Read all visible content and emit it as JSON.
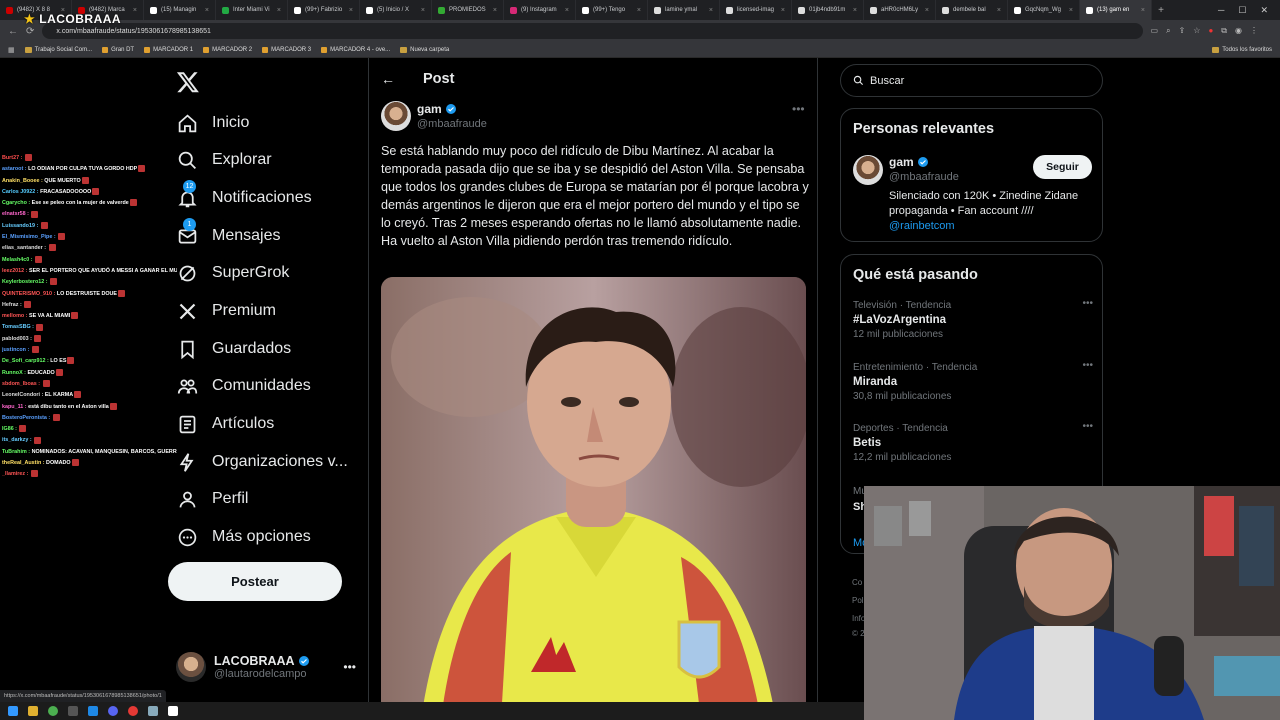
{
  "browser": {
    "tabs": [
      {
        "label": "(9482) X  8 8",
        "color": "#cc0000"
      },
      {
        "label": "(9482) Marca",
        "color": "#cc0000"
      },
      {
        "label": "(15) Managin",
        "color": "#ffffff"
      },
      {
        "label": "Inter Miami Vi",
        "color": "#22aa44"
      },
      {
        "label": "(99+) Fabrizio",
        "color": "#ffffff"
      },
      {
        "label": "(5) Inicio / X",
        "color": "#ffffff"
      },
      {
        "label": "PROMIEDOS",
        "color": "#33aa33"
      },
      {
        "label": "(9) Instagram",
        "color": "#d62976"
      },
      {
        "label": "(99+) Tengo",
        "color": "#ffffff"
      },
      {
        "label": "lamine ymal",
        "color": "#dddddd"
      },
      {
        "label": "licensed-imag",
        "color": "#dddddd"
      },
      {
        "label": "01jb4ndb91m",
        "color": "#dddddd"
      },
      {
        "label": "aHR0cHM6Ly",
        "color": "#dddddd"
      },
      {
        "label": "dembele bal",
        "color": "#dddddd"
      },
      {
        "label": "GqcNqm_Wg",
        "color": "#ffffff"
      },
      {
        "label": "(13) gam en",
        "color": "#ffffff"
      }
    ],
    "url": "x.com/mbaafraude/status/1953061678985138651",
    "bookmarks": [
      "Trabajo Social Com...",
      "Gran DT",
      "MARCADOR 1",
      "MARCADOR 2",
      "MARCADOR 3",
      "MARCADOR 4 - ove...",
      "Nueva carpeta"
    ],
    "all_bookmarks": "Todos los favoritos",
    "status_url": "https://x.com/mbaafraude/status/1953061678985138651/photo/1"
  },
  "overlay_logo": "LACOBRAAA",
  "chat": [
    {
      "user": "Burt27 :",
      "msg": "",
      "color": "#ff4d4d"
    },
    {
      "user": "astaroot :",
      "msg": "LO ODIAN POR CULPA TUYA GORDO HDP",
      "color": "#5aa0ff"
    },
    {
      "user": "Anakin_Booee :",
      "msg": "QUE MUERTO",
      "color": "#ffe066"
    },
    {
      "user": "Carlos J0922 :",
      "msg": "FRACASADOOOOO",
      "color": "#55ccff"
    },
    {
      "user": "Cgarycho :",
      "msg": "Ese se peleo con la mujer de valverde",
      "color": "#66ff66"
    },
    {
      "user": "elnatsr58 :",
      "msg": "",
      "color": "#ff66cc"
    },
    {
      "user": "Luissando19 :",
      "msg": "",
      "color": "#66ccff"
    },
    {
      "user": "El_Mismisimo_Pipe :",
      "msg": "",
      "color": "#5aa0ff"
    },
    {
      "user": "elias_santander :",
      "msg": "",
      "color": "#dddddd"
    },
    {
      "user": "Melash4c0 :",
      "msg": "",
      "color": "#66ff66"
    },
    {
      "user": "leez2012 :",
      "msg": "SER EL PORTERO QUE AYUDÓ A MESSI A GANAR EL MUNDIAL COGIDOS",
      "color": "#ff5555"
    },
    {
      "user": "Keylerbostero12 :",
      "msg": "",
      "color": "#66ff66"
    },
    {
      "user": "QUINTERISMO_910 :",
      "msg": "LO DESTRUISTE DOUE",
      "color": "#ff5555"
    },
    {
      "user": "Hefraz :",
      "msg": "",
      "color": "#dddddd"
    },
    {
      "user": "mellomo :",
      "msg": "SE VA AL MIAMI",
      "color": "#ff5555"
    },
    {
      "user": "TomasSBG :",
      "msg": "",
      "color": "#66ccff"
    },
    {
      "user": "pablod003 :",
      "msg": "",
      "color": "#dddddd"
    },
    {
      "user": "justincon :",
      "msg": "",
      "color": "#5aa0ff"
    },
    {
      "user": "De_Sofi_carp912 :",
      "msg": "LO ES",
      "color": "#66ff66"
    },
    {
      "user": "RunnoX :",
      "msg": "EDUCADO",
      "color": "#66ff66"
    },
    {
      "user": "sbdom_lboas :",
      "msg": "",
      "color": "#ff5555"
    },
    {
      "user": "LeonelCondori :",
      "msg": "EL KARMA",
      "color": "#dddddd"
    },
    {
      "user": "kapu_11 :",
      "msg": "está dibu tanto en el Aston villa",
      "color": "#ff66cc"
    },
    {
      "user": "BosteroPeronista :",
      "msg": "",
      "color": "#5aa0ff"
    },
    {
      "user": "IG86 :",
      "msg": "",
      "color": "#66ff66"
    },
    {
      "user": "its_darkzy :",
      "msg": "",
      "color": "#66ccff"
    },
    {
      "user": "TuBrahim :",
      "msg": "NOMINADOS: ACAVANI, MANQUESIN, BARCOS, GUERRERO",
      "color": "#66ff66"
    },
    {
      "user": "theReal_Austin :",
      "msg": "DOMADO",
      "color": "#ffe066"
    },
    {
      "user": "_llamirez :",
      "msg": "",
      "color": "#ff5555"
    }
  ],
  "nav": [
    {
      "label": "Inicio",
      "icon": "home-icon"
    },
    {
      "label": "Explorar",
      "icon": "search-icon"
    },
    {
      "label": "Notificaciones",
      "icon": "bell-icon",
      "badge": "12"
    },
    {
      "label": "Mensajes",
      "icon": "mail-icon",
      "badge": "1"
    },
    {
      "label": "SuperGrok",
      "icon": "grok-icon"
    },
    {
      "label": "Premium",
      "icon": "x-premium-icon"
    },
    {
      "label": "Guardados",
      "icon": "bookmark-icon"
    },
    {
      "label": "Comunidades",
      "icon": "people-icon"
    },
    {
      "label": "Artículos",
      "icon": "article-icon"
    },
    {
      "label": "Organizaciones v...",
      "icon": "lightning-icon"
    },
    {
      "label": "Perfil",
      "icon": "profile-icon"
    },
    {
      "label": "Más opciones",
      "icon": "more-circle-icon"
    }
  ],
  "post_button": "Postear",
  "account": {
    "name": "LACOBRAAA",
    "handle": "@lautarodelcampo"
  },
  "post": {
    "header": "Post",
    "author_name": "gam",
    "author_handle": "@mbaafraude",
    "text": "Se está hablando muy poco del ridículo de Dibu Martínez. Al acabar la temporada pasada dijo que se iba y se despidió del Aston Villa. Se pensaba que todos los grandes clubes de Europa se matarían por él porque lacobra y demás argentinos le dijeron que era el mejor portero del mundo y el tipo se lo creyó. Tras 2 meses esperando ofertas no le llamó absolutamente nadie. Ha vuelto al Aston Villa pidiendo perdón tras tremendo ridículo."
  },
  "search": {
    "placeholder": "Buscar"
  },
  "relevant": {
    "title": "Personas relevantes",
    "name": "gam",
    "handle": "@mbaafraude",
    "follow": "Seguir",
    "bio": "Silenciado con 120K • Zinedine Zidane propaganda • Fan account ////",
    "link": "@rainbetcom"
  },
  "trends": {
    "title": "Qué está pasando",
    "items": [
      {
        "category": "Televisión · Tendencia",
        "name": "#LaVozArgentina",
        "count": "12 mil publicaciones"
      },
      {
        "category": "Entretenimiento · Tendencia",
        "name": "Miranda",
        "count": "30,8 mil publicaciones"
      },
      {
        "category": "Deportes · Tendencia",
        "name": "Betis",
        "count": "12,2 mil publicaciones"
      }
    ]
  },
  "colors": {
    "accent": "#1d9bf0",
    "bg": "#000000",
    "text": "#e7e9ea",
    "muted": "#71767b"
  }
}
